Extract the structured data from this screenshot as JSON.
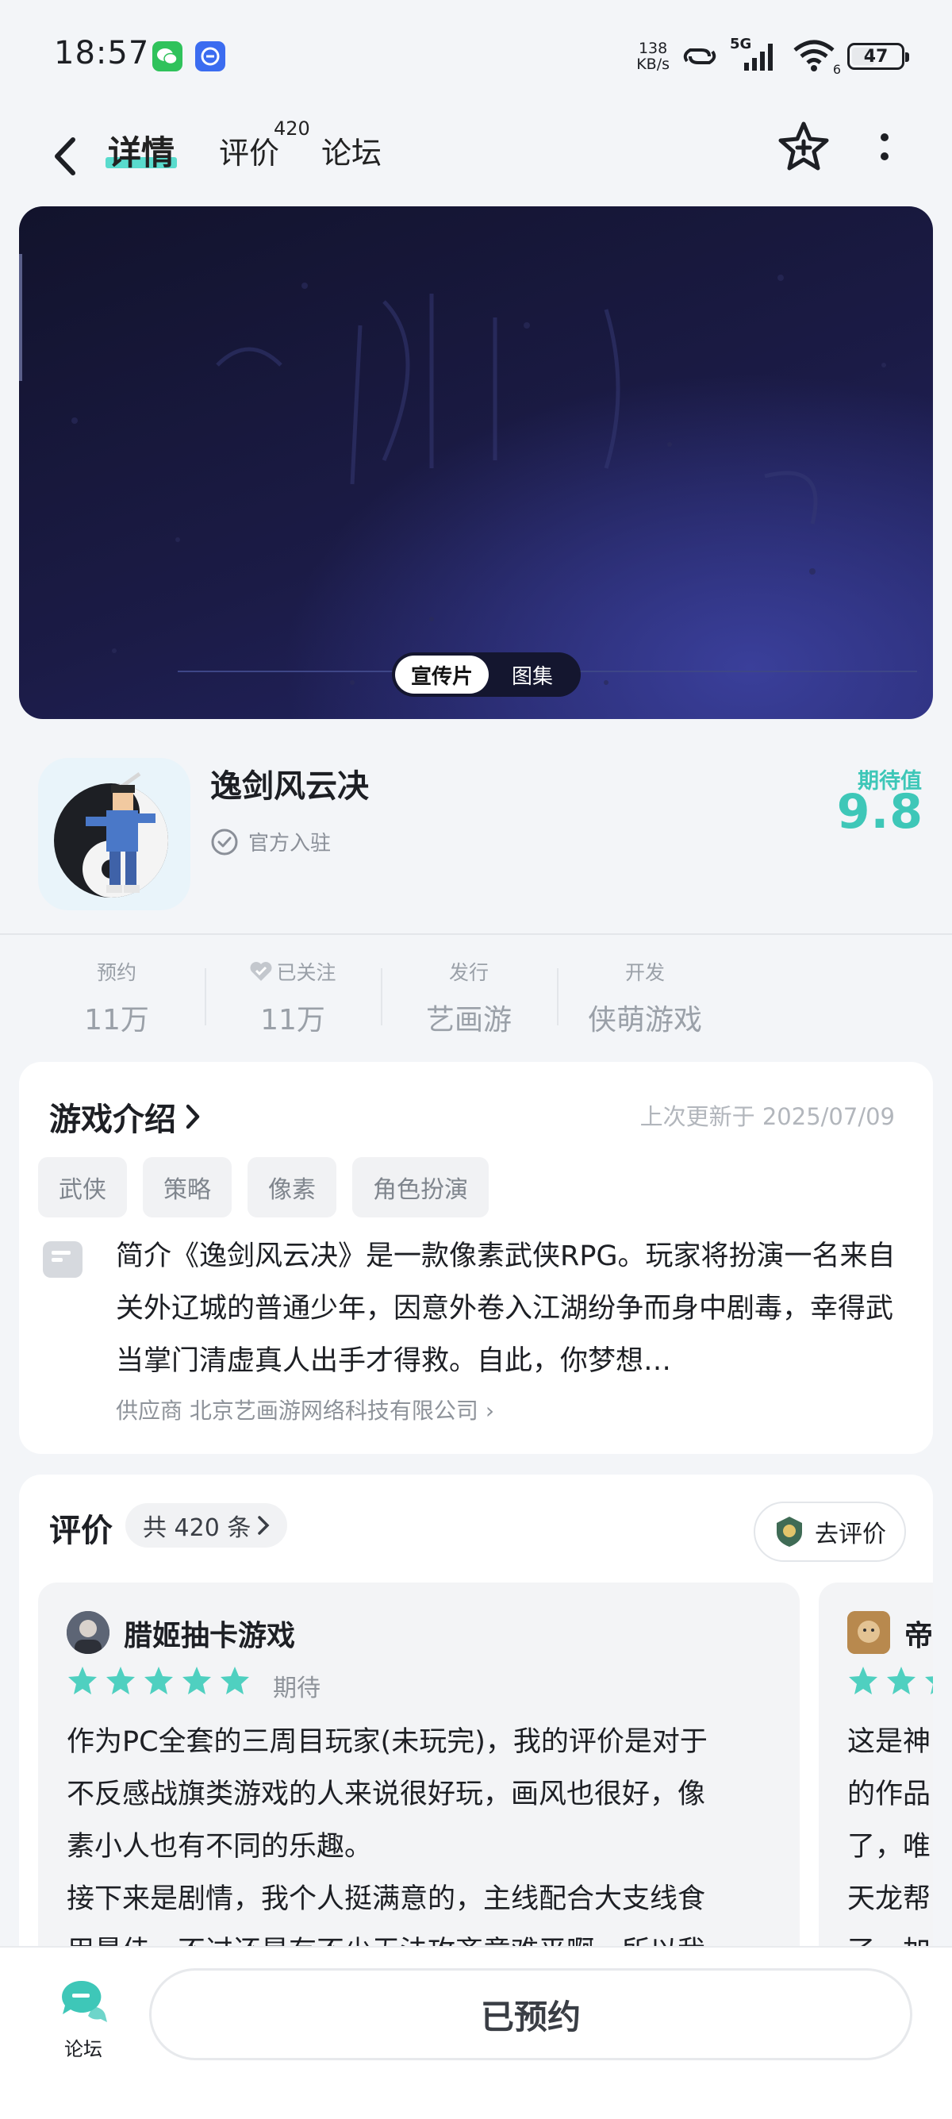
{
  "status_bar": {
    "time": "18:57",
    "net_speed_value": "138",
    "net_speed_unit": "KB/s",
    "network": "5G",
    "wifi_badge": "6",
    "battery": "47",
    "battery_level": 0.47
  },
  "nav": {
    "tabs": [
      "详情",
      "评价",
      "论坛"
    ],
    "active_tab": "详情",
    "review_badge": "420"
  },
  "media": {
    "toggle": [
      "宣传片",
      "图集"
    ],
    "active": "宣传片"
  },
  "game": {
    "name": "逸剑风云决",
    "official_label": "官方入驻",
    "expect_label": "期待值",
    "expect_value": "9.8"
  },
  "stats": [
    {
      "label": "预约",
      "value": "11万"
    },
    {
      "label": "已关注",
      "value": "11万"
    },
    {
      "label": "发行",
      "value": "艺画游"
    },
    {
      "label": "开发",
      "value": "侠萌游戏"
    }
  ],
  "intro": {
    "title": "游戏介绍",
    "updated": "上次更新于 2025/07/09",
    "tags": [
      "武侠",
      "策略",
      "像素",
      "角色扮演"
    ],
    "text": "简介《逸剑风云决》是一款像素武侠RPG。玩家将扮演一名来自关外辽城的普通少年，因意外卷入江湖纷争而身中剧毒，幸得武当掌门清虚真人出手才得救。自此，你梦想…",
    "supplier": "供应商 北京艺画游网络科技有限公司"
  },
  "reviews": {
    "title": "评价",
    "count": "共 420 条",
    "go_review": "去评价",
    "items": [
      {
        "user": "腊姬抽卡游戏",
        "stars": 5,
        "tag": "期待",
        "lines": [
          "作为PC全套的三周目玩家(未玩完)，我的评价是对于",
          "不反感战旗类游戏的人来说很好玩，画风也很好，像",
          "素小人也有不同的乐趣。",
          "接下来是剧情，我个人挺满意的，主线配合大支线食",
          "用最佳，不过还是有不少无法攻齐意难平啊，所以我"
        ]
      },
      {
        "user": "帝",
        "stars": 5,
        "tag": "",
        "lines": [
          "这是神",
          "的作品",
          "了，唯",
          "天龙帮",
          "了，加"
        ]
      }
    ]
  },
  "bottom": {
    "forum_label": "论坛",
    "reserved_label": "已预约"
  },
  "colors": {
    "accent": "#3ec7b8",
    "star": "#4fd0c0"
  }
}
